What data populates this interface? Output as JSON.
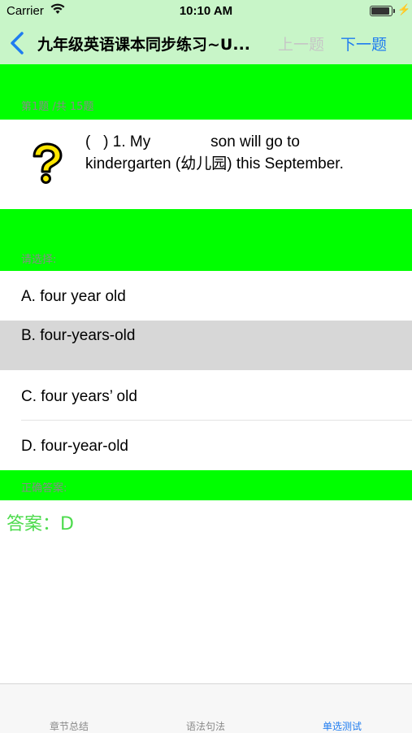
{
  "status_bar": {
    "carrier": "Carrier",
    "time": "10:10 AM",
    "wifi_icon": "wifi-icon",
    "battery_icon": "battery-charging-icon"
  },
  "nav": {
    "back_icon": "chevron-left-icon",
    "title": "九年级英语课本同步练习~U...",
    "prev_label": "上一题",
    "next_label": "下一题"
  },
  "question_header": "第1题 /共 15题",
  "question": {
    "icon": "question-mark-icon",
    "text_line1": "(   ) 1. My              son will go to",
    "text_line2": "kindergarten (幼儿园) this September."
  },
  "choose_header": "请选择:",
  "options": [
    {
      "label": "A. four year old"
    },
    {
      "label": "B. four-years-old",
      "selected": true
    },
    {
      "label": "C. four years’ old"
    },
    {
      "label": "D. four-year-old"
    }
  ],
  "answer_header": "正确答案:",
  "answer_text": "答案：D",
  "tabs": [
    {
      "label": "章节总结"
    },
    {
      "label": "语法句法"
    },
    {
      "label": "单选测试",
      "active": true
    }
  ],
  "colors": {
    "green_band": "#00ff00",
    "nav_background": "#c8f5c8",
    "selected_option_background": "#d7d7d7",
    "accent_blue": "#1f7cf0",
    "answer_green": "#4ddb4d"
  }
}
